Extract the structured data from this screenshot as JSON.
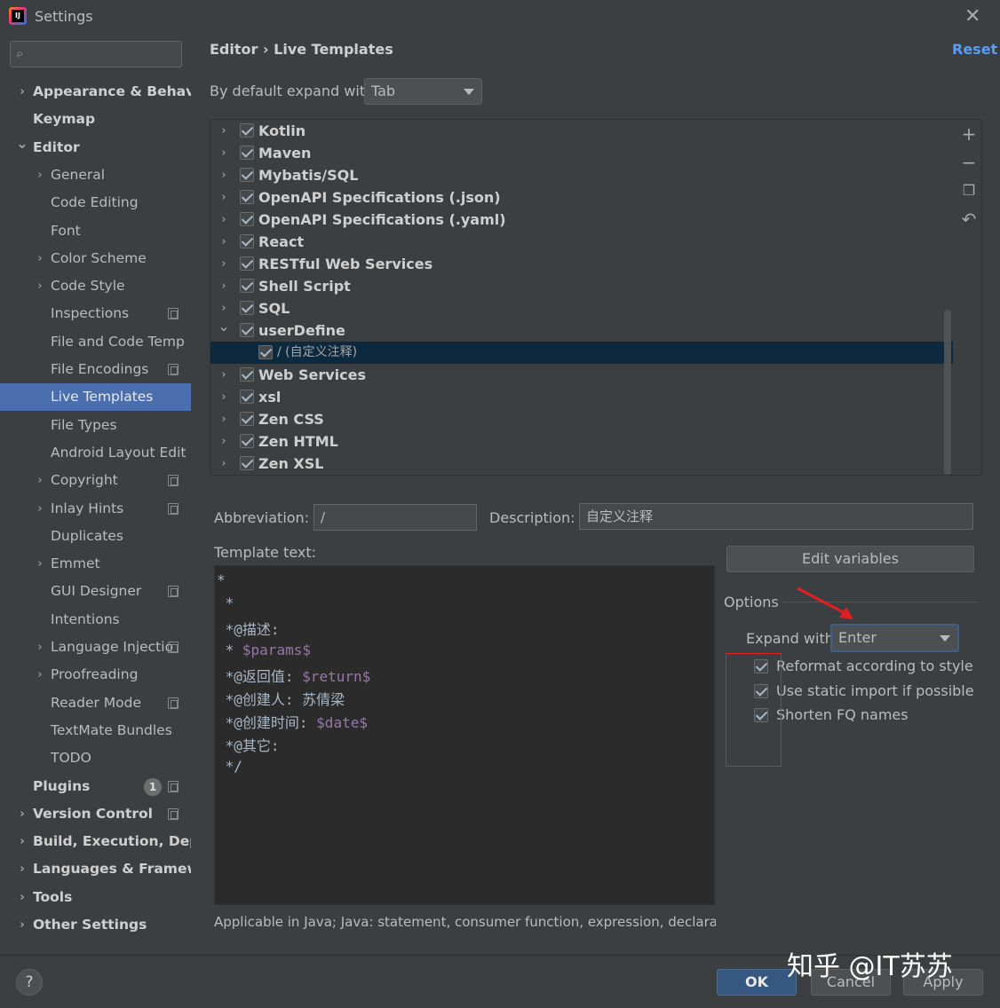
{
  "window": {
    "title": "Settings"
  },
  "search": {
    "placeholder": ""
  },
  "sidebar": {
    "items": [
      {
        "label": "Appearance & Behavi",
        "level": 0,
        "arrow": "right",
        "copy": false
      },
      {
        "label": "Keymap",
        "level": 0,
        "arrow": "",
        "copy": false
      },
      {
        "label": "Editor",
        "level": 0,
        "arrow": "down",
        "copy": false
      },
      {
        "label": "General",
        "level": 1,
        "arrow": "right",
        "copy": false
      },
      {
        "label": "Code Editing",
        "level": 1,
        "arrow": "",
        "copy": false
      },
      {
        "label": "Font",
        "level": 1,
        "arrow": "",
        "copy": false
      },
      {
        "label": "Color Scheme",
        "level": 1,
        "arrow": "right",
        "copy": false
      },
      {
        "label": "Code Style",
        "level": 1,
        "arrow": "right",
        "copy": false
      },
      {
        "label": "Inspections",
        "level": 1,
        "arrow": "",
        "copy": true
      },
      {
        "label": "File and Code Temp",
        "level": 1,
        "arrow": "",
        "copy": false
      },
      {
        "label": "File Encodings",
        "level": 1,
        "arrow": "",
        "copy": true
      },
      {
        "label": "Live Templates",
        "level": 1,
        "arrow": "",
        "copy": false,
        "selected": true
      },
      {
        "label": "File Types",
        "level": 1,
        "arrow": "",
        "copy": false
      },
      {
        "label": "Android Layout Edit",
        "level": 1,
        "arrow": "",
        "copy": false
      },
      {
        "label": "Copyright",
        "level": 1,
        "arrow": "right",
        "copy": true
      },
      {
        "label": "Inlay Hints",
        "level": 1,
        "arrow": "right",
        "copy": true
      },
      {
        "label": "Duplicates",
        "level": 1,
        "arrow": "",
        "copy": false
      },
      {
        "label": "Emmet",
        "level": 1,
        "arrow": "right",
        "copy": false
      },
      {
        "label": "GUI Designer",
        "level": 1,
        "arrow": "",
        "copy": true
      },
      {
        "label": "Intentions",
        "level": 1,
        "arrow": "",
        "copy": false
      },
      {
        "label": "Language Injectio",
        "level": 1,
        "arrow": "right",
        "copy": true
      },
      {
        "label": "Proofreading",
        "level": 1,
        "arrow": "right",
        "copy": false
      },
      {
        "label": "Reader Mode",
        "level": 1,
        "arrow": "",
        "copy": true
      },
      {
        "label": "TextMate Bundles",
        "level": 1,
        "arrow": "",
        "copy": false
      },
      {
        "label": "TODO",
        "level": 1,
        "arrow": "",
        "copy": false
      },
      {
        "label": "Plugins",
        "level": 0,
        "arrow": "",
        "copy": true,
        "badge": "1"
      },
      {
        "label": "Version Control",
        "level": 0,
        "arrow": "right",
        "copy": true
      },
      {
        "label": "Build, Execution, Depl",
        "level": 0,
        "arrow": "right",
        "copy": false
      },
      {
        "label": "Languages & Framew",
        "level": 0,
        "arrow": "right",
        "copy": false
      },
      {
        "label": "Tools",
        "level": 0,
        "arrow": "right",
        "copy": false
      },
      {
        "label": "Other Settings",
        "level": 0,
        "arrow": "right",
        "copy": false
      }
    ]
  },
  "header": {
    "breadcrumb": "Editor  ›  Live Templates",
    "reset": "Reset"
  },
  "expand_default": {
    "label": "By default expand with",
    "value": "Tab"
  },
  "template_groups": [
    {
      "label": "Kotlin",
      "arrow": "right",
      "checked": true,
      "child": false
    },
    {
      "label": "Maven",
      "arrow": "right",
      "checked": true,
      "child": false
    },
    {
      "label": "Mybatis/SQL",
      "arrow": "right",
      "checked": true,
      "child": false
    },
    {
      "label": "OpenAPI Specifications (.json)",
      "arrow": "right",
      "checked": true,
      "child": false
    },
    {
      "label": "OpenAPI Specifications (.yaml)",
      "arrow": "right",
      "checked": true,
      "child": false
    },
    {
      "label": "React",
      "arrow": "right",
      "checked": true,
      "child": false
    },
    {
      "label": "RESTful Web Services",
      "arrow": "right",
      "checked": true,
      "child": false
    },
    {
      "label": "Shell Script",
      "arrow": "right",
      "checked": true,
      "child": false
    },
    {
      "label": "SQL",
      "arrow": "right",
      "checked": true,
      "child": false
    },
    {
      "label": "userDefine",
      "arrow": "down",
      "checked": true,
      "child": false
    },
    {
      "label": "/ (自定义注释)",
      "arrow": "",
      "checked": true,
      "child": true,
      "selected": true
    },
    {
      "label": "Web Services",
      "arrow": "right",
      "checked": true,
      "child": false
    },
    {
      "label": "xsl",
      "arrow": "right",
      "checked": true,
      "child": false
    },
    {
      "label": "Zen CSS",
      "arrow": "right",
      "checked": true,
      "child": false
    },
    {
      "label": "Zen HTML",
      "arrow": "right",
      "checked": true,
      "child": false
    },
    {
      "label": "Zen XSL",
      "arrow": "right",
      "checked": true,
      "child": false
    }
  ],
  "toolbar": {
    "add": "+",
    "remove": "−",
    "copy": "❐",
    "restore": "↶"
  },
  "abbreviation": {
    "label": "Abbreviation:",
    "value": "/"
  },
  "description": {
    "label": "Description:",
    "value": "自定义注释"
  },
  "template_text": {
    "label": "Template text:",
    "lines": [
      {
        "text": "*",
        "var": ""
      },
      {
        "text": " *",
        "var": ""
      },
      {
        "text": " *@描述:",
        "var": ""
      },
      {
        "text": " * ",
        "var": "$params$"
      },
      {
        "text": " *@返回值: ",
        "var": "$return$"
      },
      {
        "text": " *@创建人: 苏倩梁",
        "var": ""
      },
      {
        "text": " *@创建时间: ",
        "var": "$date$"
      },
      {
        "text": " *@其它:",
        "var": ""
      },
      {
        "text": " */",
        "var": ""
      }
    ]
  },
  "edit_variables": "Edit variables",
  "options": {
    "title": "Options",
    "expand_with_label": "Expand with",
    "expand_with_value": "Enter",
    "checkboxes": [
      {
        "label": "Reformat according to style",
        "checked": true
      },
      {
        "label": "Use static import if possible",
        "checked": true
      },
      {
        "label": "Shorten FQ names",
        "checked": true
      }
    ]
  },
  "applicable": "Applicable in Java; Java: statement, consumer function, expression, declaration",
  "footer": {
    "help": "?",
    "ok": "OK",
    "cancel": "Cancel",
    "apply": "Apply"
  },
  "watermark": "知乎 @IT苏苏",
  "colors": {
    "selection": "#4b6eaf",
    "tree_selection": "#0d293e",
    "link": "#589df6",
    "annotation": "#e02020",
    "template_var": "#9876aa"
  }
}
